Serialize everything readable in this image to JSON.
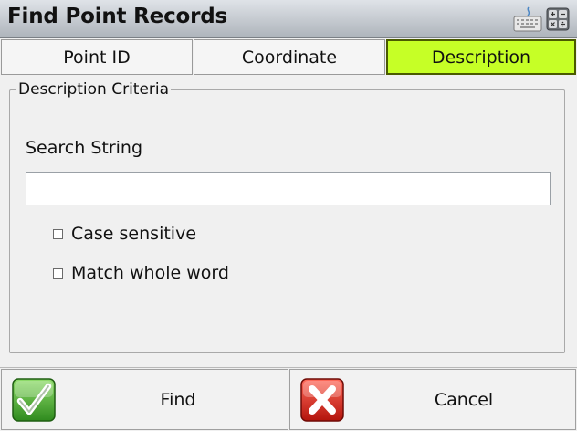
{
  "window": {
    "title": "Find Point Records"
  },
  "icons": {
    "keyboard": "keyboard-icon",
    "calculator": "calculator-icon"
  },
  "tabs": [
    {
      "label": "Point ID",
      "active": false
    },
    {
      "label": "Coordinate",
      "active": false
    },
    {
      "label": "Description",
      "active": true
    }
  ],
  "colors": {
    "active_tab": "#c6ff26"
  },
  "criteria": {
    "legend": "Description Criteria",
    "search_label": "Search String",
    "search_value": "",
    "case_sensitive": {
      "label": "Case sensitive",
      "checked": false
    },
    "whole_word": {
      "label": "Match whole word",
      "checked": false
    }
  },
  "buttons": {
    "find": {
      "label": "Find",
      "icon": "checkmark-icon"
    },
    "cancel": {
      "label": "Cancel",
      "icon": "x-icon"
    }
  }
}
